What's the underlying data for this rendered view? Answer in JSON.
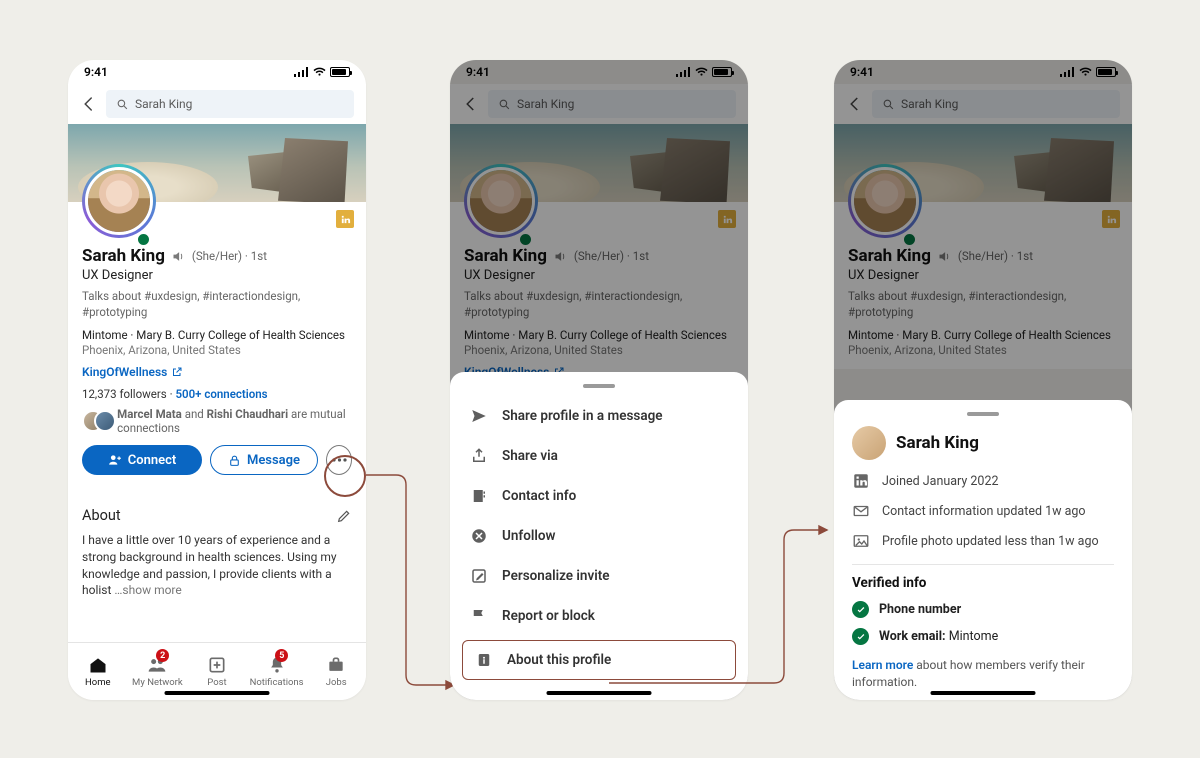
{
  "status": {
    "time": "9:41"
  },
  "search": {
    "value": "Sarah King"
  },
  "profile": {
    "name": "Sarah King",
    "pronouns": "(She/Her)",
    "degree": "1st",
    "headline": "UX Designer",
    "talks": "Talks about #uxdesign, #interactiondesign, #prototyping",
    "company_line": "Mintome · Mary B. Curry College of Health Sciences",
    "location": "Phoenix, Arizona, United States",
    "website": "KingOfWellness",
    "followers_count": "12,373",
    "followers_label": "followers",
    "connections": "500+ connections",
    "mutuals_text_a": "Marcel Mata",
    "mutuals_text_b": "Rishi Chaudhari",
    "mutuals_suffix": "are mutual connections"
  },
  "cta": {
    "connect": "Connect",
    "message": "Message"
  },
  "about": {
    "title": "About",
    "body": "I have a little over 10 years of experience and a strong background in health sciences. Using my knowledge and passion, I provide clients with a holist",
    "show_more": " …show more"
  },
  "tabs": {
    "home": "Home",
    "network": "My Network",
    "post": "Post",
    "notifications": "Notifications",
    "jobs": "Jobs",
    "badge_network": "2",
    "badge_notifications": "5"
  },
  "menu": {
    "share_msg": "Share profile in a message",
    "share_via": "Share via",
    "contact": "Contact info",
    "unfollow": "Unfollow",
    "personalize": "Personalize invite",
    "report": "Report or block",
    "about_profile": "About this profile"
  },
  "about_sheet": {
    "name": "Sarah King",
    "joined": "Joined January 2022",
    "contact_updated": "Contact information updated 1w ago",
    "photo_updated": "Profile photo updated less than 1w ago",
    "verified_title": "Verified info",
    "phone": "Phone number",
    "work_email_label": "Work email:",
    "work_email_value": "Mintome",
    "learn_more": "Learn more",
    "learn_more_suffix": " about how members verify their information."
  }
}
